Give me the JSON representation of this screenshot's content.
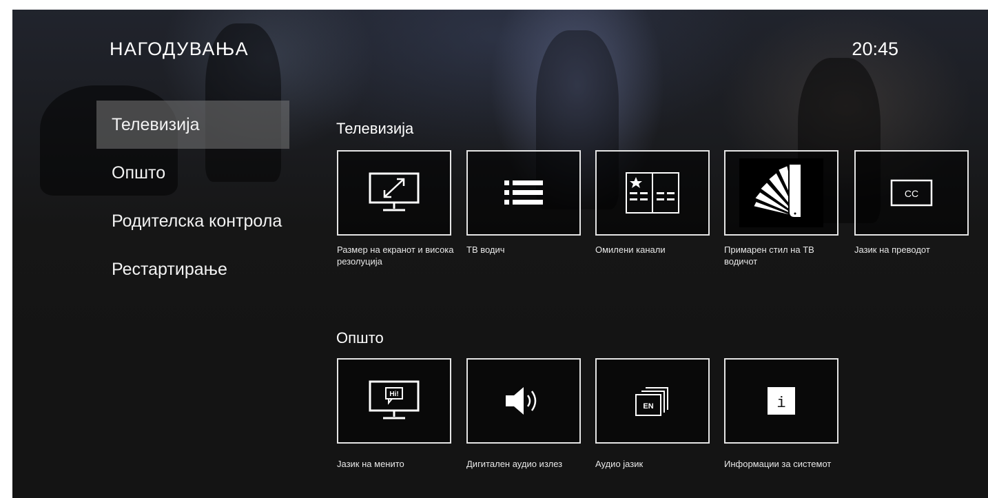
{
  "header": {
    "title": "НАГОДУВАЊА",
    "clock": "20:45"
  },
  "menu": {
    "items": [
      {
        "label": "Телевизија"
      },
      {
        "label": "Општо"
      },
      {
        "label": "Родителска контрола"
      },
      {
        "label": "Рестартирање"
      }
    ]
  },
  "sections": {
    "tv": {
      "title": "Телевизија",
      "tiles": [
        {
          "label": "Размер на екранот и висока резолуција",
          "icon": "screen-resize-icon"
        },
        {
          "label": "ТВ водич",
          "icon": "list-icon"
        },
        {
          "label": "Омилени канали",
          "icon": "favorite-channels-icon"
        },
        {
          "label": "Примарен стил на ТВ водичот",
          "icon": "fan-style-icon"
        },
        {
          "label": "Јазик на преводот",
          "icon": "cc-icon",
          "icon_text": "CC"
        }
      ]
    },
    "general": {
      "title": "Општо",
      "tiles": [
        {
          "label": "Јазик на менито",
          "icon": "menu-language-icon",
          "icon_text": "Hi!"
        },
        {
          "label": "Дигитален аудио излез",
          "icon": "speaker-icon"
        },
        {
          "label": "Аудио јазик",
          "icon": "audio-language-icon",
          "icon_text": "EN"
        },
        {
          "label": "Информации за системот",
          "icon": "info-icon",
          "icon_text": "i"
        }
      ]
    }
  },
  "colors": {
    "background": "#161616",
    "highlight": "#787878",
    "text": "#ffffff",
    "border": "#e6e6e6"
  }
}
